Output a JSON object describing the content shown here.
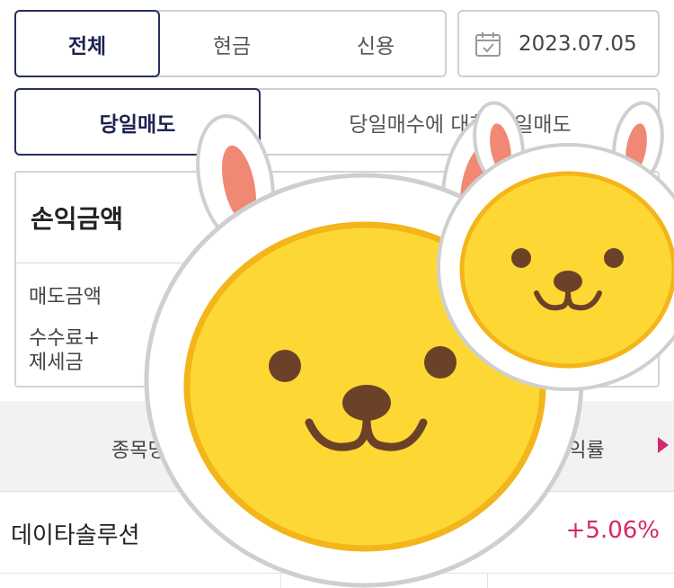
{
  "account_tabs": [
    "전체",
    "현금",
    "신용"
  ],
  "date": "2023.07.05",
  "view_tabs": [
    "당일매도",
    "당일매수에 대한 당일매도"
  ],
  "summary": {
    "title": "손익금액",
    "sell_amount_label": "매도금액",
    "fee_label_1": "수수료+",
    "fee_label_2": "제세금"
  },
  "table": {
    "header_stock": "종목명",
    "header_return": "수익률",
    "rows": [
      {
        "name": "데이타솔루션",
        "return": "+5.06%"
      }
    ]
  },
  "colors": {
    "accent_navy": "#1d2452",
    "positive": "#d6286c",
    "mascot_yellow": "#fdd835"
  },
  "icons": {
    "date": "calendar-icon",
    "scroll": "triangle-right-icon",
    "overlay": "rabbit-mascot"
  }
}
